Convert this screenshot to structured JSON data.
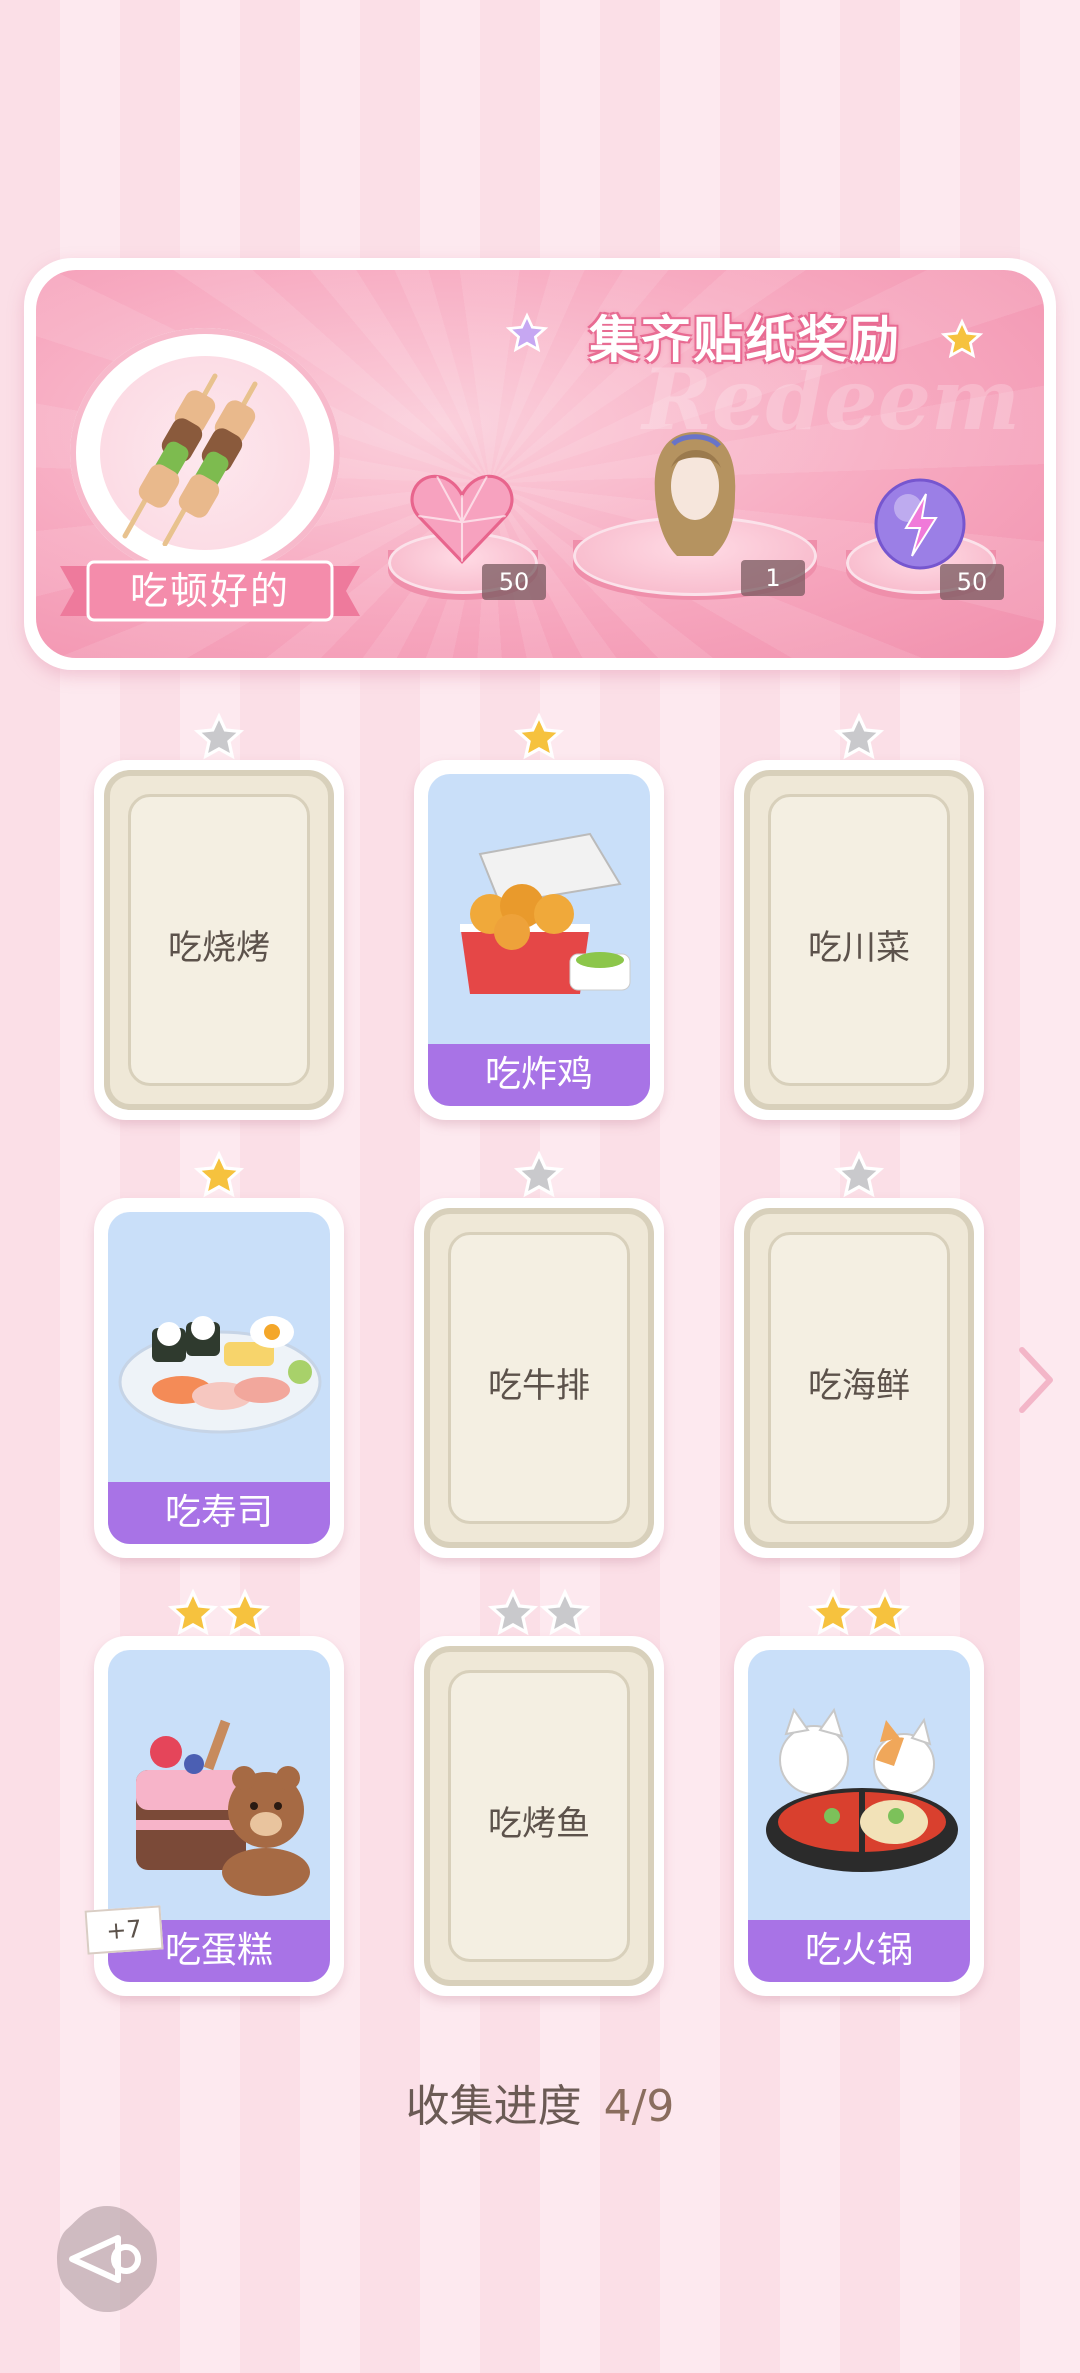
{
  "reward": {
    "title": "集齐贴纸奖励",
    "watermark": "Redeem",
    "theme_label": "吃顿好的",
    "items": [
      {
        "icon": "pink-heart-gem-icon",
        "count": "50"
      },
      {
        "icon": "hairstyle-icon",
        "count": "1"
      },
      {
        "icon": "lightning-orb-icon",
        "count": "50"
      }
    ]
  },
  "cards": [
    {
      "label": "吃烧烤",
      "collected": false,
      "stars": 1
    },
    {
      "label": "吃炸鸡",
      "collected": true,
      "stars": 1,
      "image": "fried-chicken-nuggets"
    },
    {
      "label": "吃川菜",
      "collected": false,
      "stars": 1
    },
    {
      "label": "吃寿司",
      "collected": true,
      "stars": 1,
      "image": "sushi-plate"
    },
    {
      "label": "吃牛排",
      "collected": false,
      "stars": 1
    },
    {
      "label": "吃海鲜",
      "collected": false,
      "stars": 1
    },
    {
      "label": "吃蛋糕",
      "collected": true,
      "stars": 2,
      "image": "cake-with-bear",
      "extra": "+7"
    },
    {
      "label": "吃烤鱼",
      "collected": false,
      "stars": 2
    },
    {
      "label": "吃火锅",
      "collected": true,
      "stars": 2,
      "image": "cats-hotpot"
    }
  ],
  "progress": {
    "label": "收集进度",
    "value": "4/9"
  },
  "colors": {
    "gold_star": "#f6c23e",
    "grey_star": "#c9c9cc",
    "label_purple": "#a873e6",
    "pink": "#f190ad"
  }
}
